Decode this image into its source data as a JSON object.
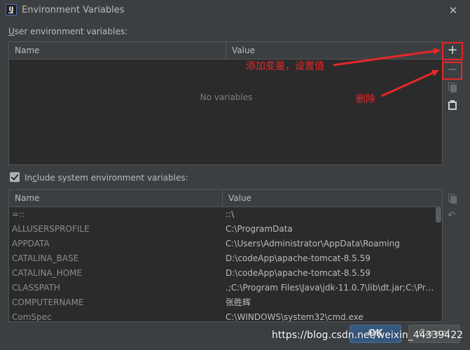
{
  "window": {
    "title": "Environment Variables",
    "close_glyph": "✕"
  },
  "user_env": {
    "label_prefix": "U",
    "label_rest": "ser environment variables:",
    "columns": [
      "Name",
      "Value"
    ],
    "empty_text": "No variables"
  },
  "toolbar": {
    "add_glyph": "+",
    "remove_glyph": "−",
    "undo_glyph": "↶",
    "icons": [
      "add-icon",
      "remove-icon",
      "copy-icon",
      "paste-icon",
      "undo-icon"
    ]
  },
  "annotations": {
    "add_text": "添加变量，设置值",
    "remove_text": "删除",
    "color": "#e5272a"
  },
  "system_env": {
    "checked": true,
    "label_prefix": "In",
    "label_underlined": "c",
    "label_rest": "lude system environment variables:",
    "columns": [
      "Name",
      "Value"
    ],
    "rows": [
      {
        "name": "=::",
        "value": "::\\"
      },
      {
        "name": "ALLUSERSPROFILE",
        "value": "C:\\ProgramData"
      },
      {
        "name": "APPDATA",
        "value": "C:\\Users\\Administrator\\AppData\\Roaming"
      },
      {
        "name": "CATALINA_BASE",
        "value": "D:\\codeApp\\apache-tomcat-8.5.59"
      },
      {
        "name": "CATALINA_HOME",
        "value": "D:\\codeApp\\apache-tomcat-8.5.59"
      },
      {
        "name": "CLASSPATH",
        "value": ".;C:\\Program Files\\Java\\jdk-11.0.7\\lib\\dt.jar;C:\\Pro..."
      },
      {
        "name": "COMPUTERNAME",
        "value": "张胜辉"
      },
      {
        "name": "ComSpec",
        "value": "C:\\WINDOWS\\system32\\cmd.exe"
      }
    ]
  },
  "buttons": {
    "ok": "OK",
    "cancel": "Cancel"
  },
  "watermark": "https://blog.csdn.net/weixin_44339422",
  "colors": {
    "background": "#3c3f41",
    "table_bg": "#2b2b2b",
    "ok_accent": "#365880"
  }
}
